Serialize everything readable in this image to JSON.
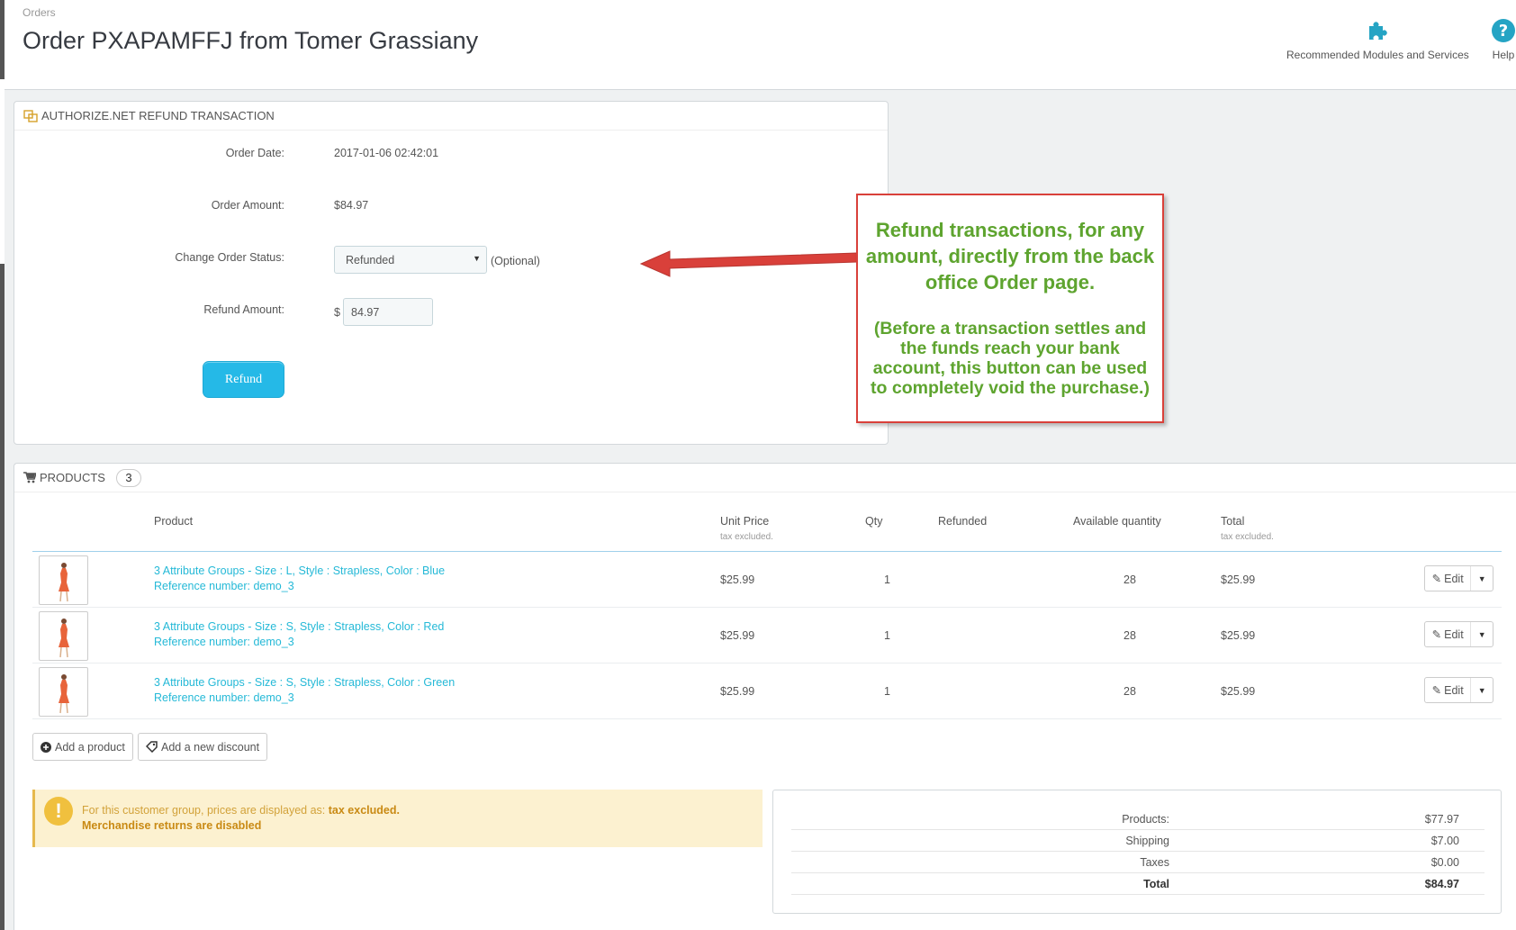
{
  "header": {
    "breadcrumb": "Orders",
    "title": "Order PXAPAMFFJ from Tomer Grassiany",
    "toolbar": [
      {
        "label": "Recommended Modules and Services",
        "icon": "puzzle-icon"
      },
      {
        "label": "Help",
        "icon": "help-icon"
      }
    ]
  },
  "refund_panel": {
    "heading": "AUTHORIZE.NET REFUND TRANSACTION",
    "order_date_label": "Order Date:",
    "order_date": "2017-01-06 02:42:01",
    "order_amount_label": "Order Amount:",
    "order_amount": "$84.97",
    "status_label": "Change Order Status:",
    "status_value": "Refunded",
    "optional": "(Optional)",
    "refund_amount_label": "Refund Amount:",
    "currency_symbol": "$",
    "refund_amount": "84.97",
    "refund_button": "Refund"
  },
  "callout": {
    "main": "Refund transactions, for any amount, directly from the back office Order page.",
    "sub": "(Before a transaction settles and the funds reach your bank account, this button can be used to completely void the purchase.)",
    "border_color": "#d9403a",
    "text_color": "#5ea42f"
  },
  "products_panel": {
    "heading": "PRODUCTS",
    "count": "3",
    "columns": {
      "product": "Product",
      "unit_price": "Unit Price",
      "unit_price_note": "tax excluded.",
      "qty": "Qty",
      "refunded": "Refunded",
      "available": "Available quantity",
      "total": "Total",
      "total_note": "tax excluded."
    },
    "rows": [
      {
        "name": "3 Attribute Groups - Size : L, Style : Strapless, Color : Blue",
        "ref": "Reference number: demo_3",
        "price": "$25.99",
        "qty": "1",
        "available": "28",
        "total": "$25.99",
        "edit": "Edit"
      },
      {
        "name": "3 Attribute Groups - Size : S, Style : Strapless, Color : Red",
        "ref": "Reference number: demo_3",
        "price": "$25.99",
        "qty": "1",
        "available": "28",
        "total": "$25.99",
        "edit": "Edit"
      },
      {
        "name": "3 Attribute Groups - Size : S, Style : Strapless, Color : Green",
        "ref": "Reference number: demo_3",
        "price": "$25.99",
        "qty": "1",
        "available": "28",
        "total": "$25.99",
        "edit": "Edit"
      }
    ],
    "add_product": "Add a product",
    "add_discount": "Add a new discount",
    "alert_line1": "For this customer group, prices are displayed as:",
    "alert_line1_bold": "tax excluded.",
    "alert_line2": "Merchandise returns are disabled",
    "totals": [
      {
        "label": "Products:",
        "value": "$77.97"
      },
      {
        "label": "Shipping",
        "value": "$7.00"
      },
      {
        "label": "Taxes",
        "value": "$0.00"
      },
      {
        "label": "Total",
        "value": "$84.97"
      }
    ]
  },
  "colors": {
    "accent": "#25b9e7",
    "link": "#25b9d7",
    "alert_bg": "#fcf1d0"
  }
}
